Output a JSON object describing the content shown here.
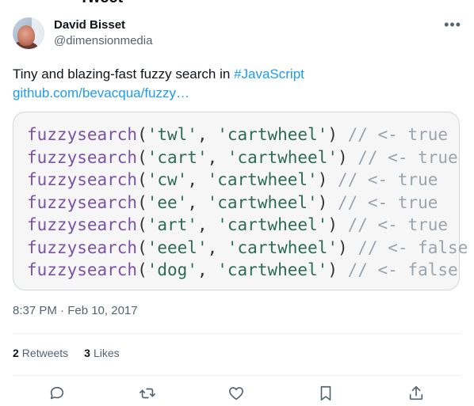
{
  "header": {
    "title": "Tweet"
  },
  "author": {
    "display_name": "David Bisset",
    "handle": "@dimensionmedia"
  },
  "more_glyph": "•••",
  "tweet": {
    "text": "Tiny and blazing-fast fuzzy search in ",
    "hashtag": "#JavaScript",
    "link": "github.com/bevacqua/fuzzy…"
  },
  "code": [
    {
      "fn": "fuzzysearch",
      "q": "'twl'",
      "target": "'cartwheel'",
      "comment": "// <- true"
    },
    {
      "fn": "fuzzysearch",
      "q": "'cart'",
      "target": "'cartwheel'",
      "comment": "// <- true"
    },
    {
      "fn": "fuzzysearch",
      "q": "'cw'",
      "target": "'cartwheel'",
      "comment": "// <- true"
    },
    {
      "fn": "fuzzysearch",
      "q": "'ee'",
      "target": "'cartwheel'",
      "comment": "// <- true"
    },
    {
      "fn": "fuzzysearch",
      "q": "'art'",
      "target": "'cartwheel'",
      "comment": "// <- true"
    },
    {
      "fn": "fuzzysearch",
      "q": "'eeel'",
      "target": "'cartwheel'",
      "comment": "// <- false"
    },
    {
      "fn": "fuzzysearch",
      "q": "'dog'",
      "target": "'cartwheel'",
      "comment": "// <- false"
    }
  ],
  "timestamp": "8:37 PM · Feb 10, 2017",
  "stats": {
    "retweets_count": "2",
    "retweets_label": "Retweets",
    "likes_count": "3",
    "likes_label": "Likes"
  },
  "actions": [
    "reply-icon",
    "retweet-icon",
    "like-icon",
    "bookmark-icon",
    "share-icon"
  ],
  "colors": {
    "accent": "#1d9bf0",
    "text": "#0f1419",
    "muted": "#536471",
    "code_fn": "#7a52a8",
    "code_string": "#2d6b58",
    "code_comment": "#9aa4ae"
  }
}
